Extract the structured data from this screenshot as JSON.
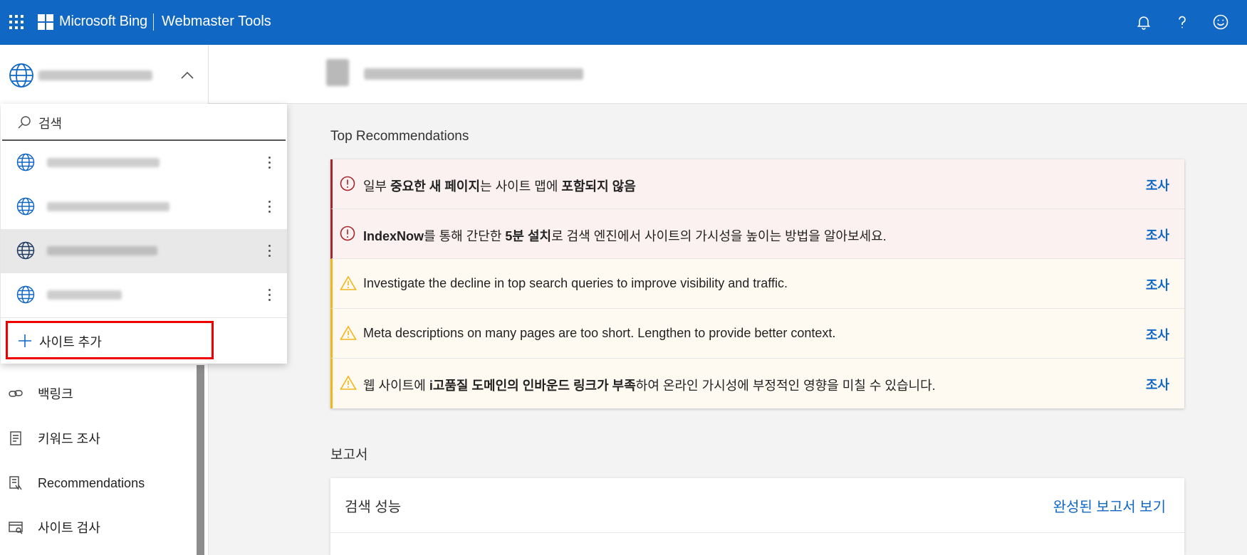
{
  "topbar": {
    "brand": "Microsoft Bing",
    "product": "Webmaster Tools",
    "icons": [
      "apps-icon",
      "microsoft-logo",
      "bell-icon",
      "help-icon",
      "feedback-smiley-icon"
    ]
  },
  "site_selector": {
    "current_site": "[blurred]",
    "icons": [
      "globe-icon",
      "chevron-up-icon"
    ]
  },
  "dropdown": {
    "search_placeholder": "검색",
    "sites": [
      {
        "name": "[blurred]"
      },
      {
        "name": "[blurred]"
      },
      {
        "name": "[blurred]",
        "selected": true
      },
      {
        "name": "[blurred]"
      }
    ],
    "add_site_label": "사이트 추가",
    "highlight_color": "#ee0000"
  },
  "nav": [
    {
      "label": "백링크",
      "icon": "link-icon"
    },
    {
      "label": "키워드 조사",
      "icon": "document-icon"
    },
    {
      "label": "Recommendations",
      "icon": "report-icon"
    },
    {
      "label": "사이트 검사",
      "icon": "site-scan-icon"
    }
  ],
  "content": {
    "site_url": "[blurred]",
    "top_rec_title": "Top Recommendations",
    "recommendations": [
      {
        "severity": "error",
        "parts": [
          [
            "일부 ",
            false
          ],
          [
            "중요한 새 페이지",
            true
          ],
          [
            "는 사이트 맵에 ",
            false
          ],
          [
            "포함되지 않음",
            true
          ]
        ],
        "action": "조사"
      },
      {
        "severity": "error",
        "parts": [
          [
            "IndexNow",
            true
          ],
          [
            "를 통해 간단한 ",
            false
          ],
          [
            "5분 설치",
            true
          ],
          [
            "로 검색 엔진에서 사이트의 가시성을 높이는 방법을 알아보세요.",
            false
          ]
        ],
        "action": "조사"
      },
      {
        "severity": "warning",
        "parts": [
          [
            "Investigate the decline in top search queries to improve visibility and traffic.",
            false
          ]
        ],
        "action": "조사"
      },
      {
        "severity": "warning",
        "parts": [
          [
            "Meta descriptions on many pages are too short. Lengthen to provide better context.",
            false
          ]
        ],
        "action": "조사"
      },
      {
        "severity": "warning",
        "parts": [
          [
            "웹 사이트에 ",
            false
          ],
          [
            "i고품질 도메인의 인바운드 링크가 부족",
            true
          ],
          [
            "하여 온라인 가시성에 부정적인 영향을 미칠 수 있습니다.",
            false
          ]
        ],
        "action": "조사"
      }
    ],
    "reports_title": "보고서",
    "report_card": {
      "title": "검색 성능",
      "link": "완성된 보고서 보기"
    }
  },
  "colors": {
    "brand_blue": "#1167c4",
    "error": "#a4262c",
    "warning": "#f2b51a"
  }
}
